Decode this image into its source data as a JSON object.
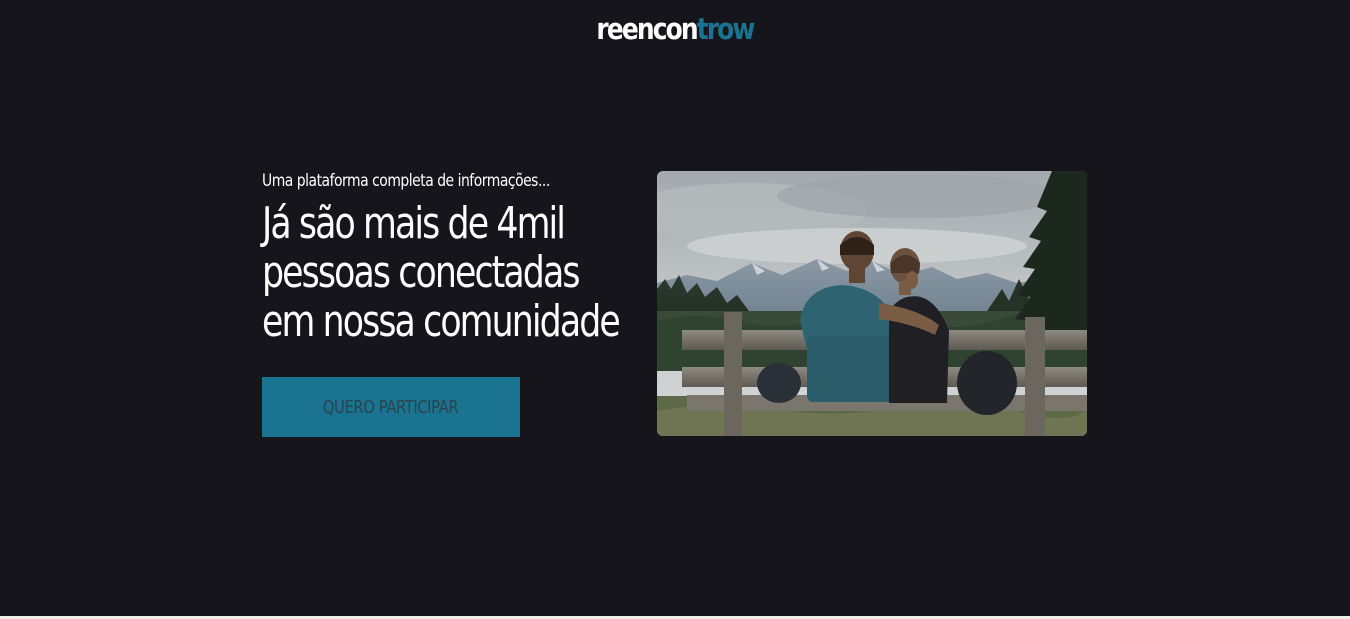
{
  "header": {
    "logo_part1": "reencon",
    "logo_part2": "trow"
  },
  "hero": {
    "tagline": "Uma plataforma completa de informações...",
    "headline_lines": [
      "Já são mais de 4mil",
      "pessoas conectadas",
      "em nossa comunidade"
    ],
    "cta_label": "QUERO PARTICIPAR"
  },
  "colors": {
    "background": "#15151b",
    "accent": "#1a7390",
    "text": "#ffffff"
  }
}
